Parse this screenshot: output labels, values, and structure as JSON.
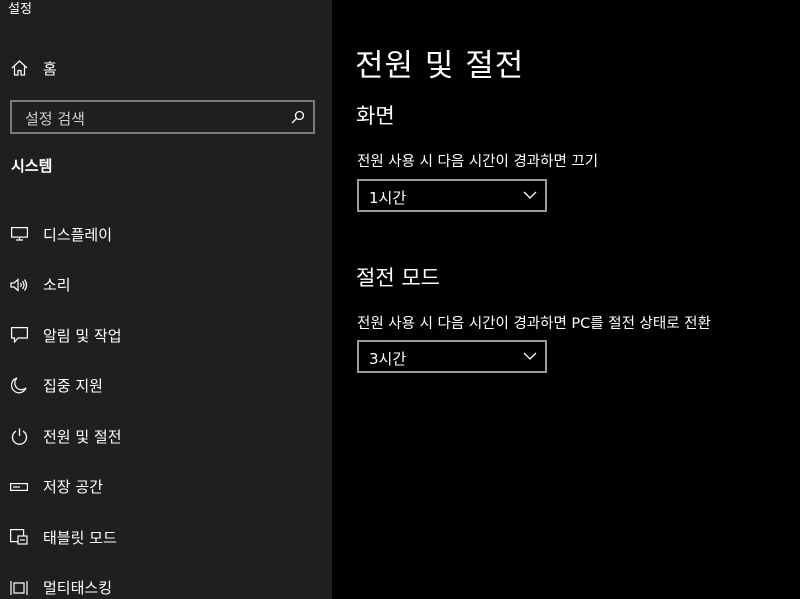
{
  "window": {
    "title": "설정"
  },
  "sidebar": {
    "home_label": "홈",
    "search": {
      "placeholder": "설정 검색"
    },
    "section_heading": "시스템",
    "items": [
      {
        "label": "디스플레이",
        "icon": "display-icon"
      },
      {
        "label": "소리",
        "icon": "speaker-icon"
      },
      {
        "label": "알림 및 작업",
        "icon": "notification-icon"
      },
      {
        "label": "집중 지원",
        "icon": "moon-icon"
      },
      {
        "label": "전원 및 절전",
        "icon": "power-icon"
      },
      {
        "label": "저장 공간",
        "icon": "storage-icon"
      },
      {
        "label": "태블릿 모드",
        "icon": "tablet-mode-icon"
      },
      {
        "label": "멀티태스킹",
        "icon": "multitasking-icon"
      }
    ]
  },
  "main": {
    "title": "전원 및 절전",
    "screen": {
      "heading": "화면",
      "label": "전원 사용 시 다음 시간이 경과하면 끄기",
      "value": "1시간"
    },
    "sleep": {
      "heading": "절전 모드",
      "label": "전원 사용 시 다음 시간이 경과하면 PC를 절전 상태로 전환",
      "value": "3시간"
    }
  },
  "colors": {
    "sidebar_bg": "#1f1f1f",
    "main_bg": "#000000",
    "text": "#ffffff",
    "border": "#9a9a9a"
  }
}
